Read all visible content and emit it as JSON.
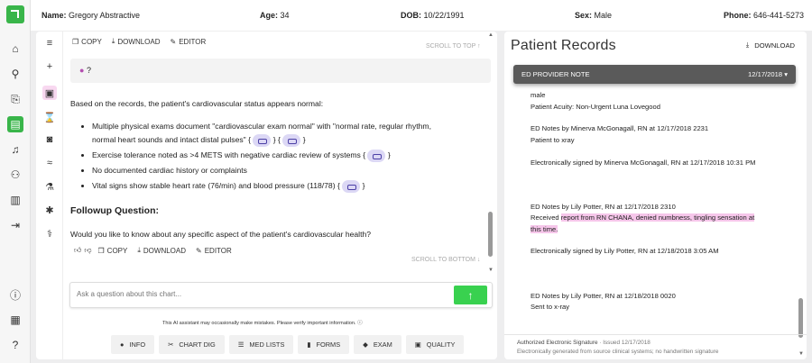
{
  "patient": {
    "name_label": "Name:",
    "name": "Gregory Abstractive",
    "age_label": "Age:",
    "age": "34",
    "dob_label": "DOB:",
    "dob": "10/22/1991",
    "sex_label": "Sex:",
    "sex": "Male",
    "phone_label": "Phone:",
    "phone": "646-441-5273"
  },
  "nav": {
    "items": [
      "home-icon",
      "search-icon",
      "add-document-icon",
      "notes-icon",
      "bell-icon",
      "user-icon",
      "chart-bar-icon",
      "logout-icon",
      "info-icon",
      "calendar-icon",
      "help-icon"
    ],
    "active": "notes-icon",
    "accent": "#39b54a"
  },
  "toolbar": {
    "copy": "COPY",
    "download": "DOWNLOAD",
    "editor": "EDITOR",
    "scroll_top": "SCROLL TO TOP ↑"
  },
  "question": {
    "text": "?"
  },
  "answer": {
    "intro": "Based on the records, the patient's cardiovascular status appears normal:",
    "bullets": [
      "Multiple physical exams document \"cardiovascular exam normal\" with \"normal rate, regular rhythm,",
      "normal heart sounds and intact distal pulses\" {",
      "}",
      "}",
      "Exercise tolerance noted as >4 METS with negative cardiac review of systems {",
      "}",
      "No documented cardiac history or complaints",
      "Vital signs show stable heart rate (76/min) and blood pressure (118/78) {",
      "}"
    ]
  },
  "followup": {
    "heading": "Followup Question:",
    "text": "Would you like to know about any specific aspect of the patient's cardiovascular health?"
  },
  "toolbar2": {
    "copy": "COPY",
    "download": "DOWNLOAD",
    "editor": "EDITOR",
    "scroll_bottom": "SCROLL TO BOTTOM ↓"
  },
  "input": {
    "placeholder": "Ask a question about this chart..."
  },
  "disclaimer": "This AI assistant may occasionally make mistakes. Please verify important information.",
  "quick_buttons": [
    "INFO",
    "CHART DIG",
    "MED LISTS",
    "FORMS",
    "EXAM",
    "QUALITY"
  ],
  "records": {
    "title": "Patient Records",
    "download": "DOWNLOAD",
    "selected_note": "ED PROVIDER NOTE",
    "selected_date": "12/17/2018",
    "lines": [
      "male",
      "Patient Acuity: Non-Urgent Luna Lovegood",
      "ED Notes by Minerva McGonagall, RN at 12/17/2018 2231",
      "Patient to xray",
      "Electronically signed by Minerva McGonagall, RN at 12/17/2018 10:31 PM",
      "ED Notes by Lily Potter, RN at 12/17/2018 2310",
      "Received ",
      "report from RN CHANA, denied numbness, tingling sensation at",
      "this time.",
      "Electronically signed by Lily Potter, RN at 12/18/2018 3:05 AM",
      "ED Notes by Lily Potter, RN at 12/18/2018 0020",
      "Sent to x-ray"
    ],
    "footer_title": "Authorized Electronic Signature",
    "footer_issued": "· Issued 12/17/2018",
    "footer_sub": "Electronically generated from source clinical systems; no handwritten signature"
  }
}
